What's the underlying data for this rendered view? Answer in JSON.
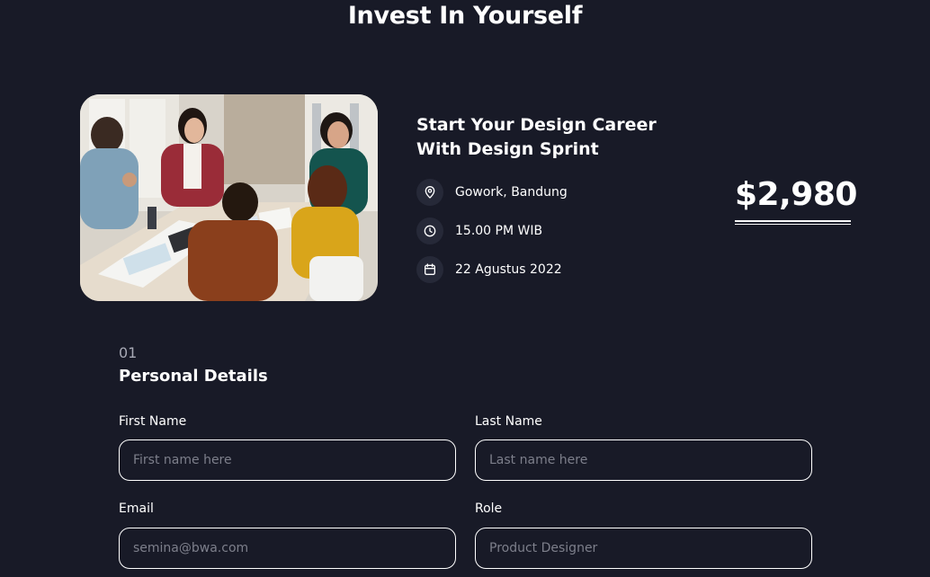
{
  "page": {
    "title": "Invest In Yourself"
  },
  "event": {
    "title_line1": "Start Your Design Career",
    "title_line2": "With Design Sprint",
    "location": "Gowork, Bandung",
    "time": "15.00 PM WIB",
    "date": "22 Agustus 2022",
    "price": "$2,980",
    "icons": [
      "map-pin-icon",
      "clock-icon",
      "calendar-icon"
    ]
  },
  "form": {
    "step": "01",
    "section_title": "Personal Details",
    "fields": {
      "first_name": {
        "label": "First Name",
        "placeholder": "First name here",
        "value": ""
      },
      "last_name": {
        "label": "Last Name",
        "placeholder": "Last name here",
        "value": ""
      },
      "email": {
        "label": "Email",
        "placeholder": "semina@bwa.com",
        "value": ""
      },
      "role": {
        "label": "Role",
        "placeholder": "Product Designer",
        "value": ""
      }
    }
  },
  "colors": {
    "background": "#181a27",
    "text": "#ffffff",
    "muted": "#a7a9b5",
    "icon_bg": "#262938",
    "placeholder": "#7d7f8b"
  }
}
